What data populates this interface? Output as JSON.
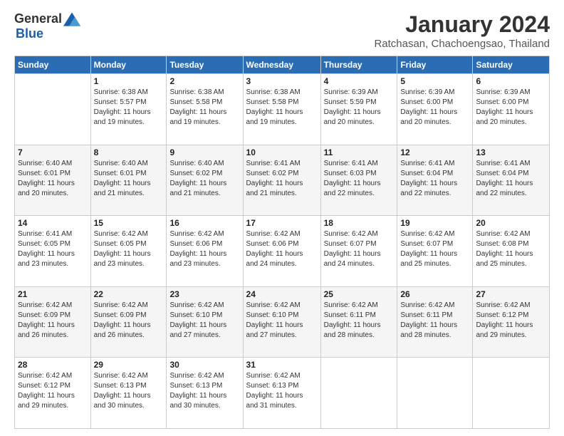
{
  "logo": {
    "general": "General",
    "blue": "Blue"
  },
  "title": "January 2024",
  "location": "Ratchasan, Chachoengsao, Thailand",
  "weekdays": [
    "Sunday",
    "Monday",
    "Tuesday",
    "Wednesday",
    "Thursday",
    "Friday",
    "Saturday"
  ],
  "weeks": [
    [
      {
        "day": "",
        "info": ""
      },
      {
        "day": "1",
        "info": "Sunrise: 6:38 AM\nSunset: 5:57 PM\nDaylight: 11 hours\nand 19 minutes."
      },
      {
        "day": "2",
        "info": "Sunrise: 6:38 AM\nSunset: 5:58 PM\nDaylight: 11 hours\nand 19 minutes."
      },
      {
        "day": "3",
        "info": "Sunrise: 6:38 AM\nSunset: 5:58 PM\nDaylight: 11 hours\nand 19 minutes."
      },
      {
        "day": "4",
        "info": "Sunrise: 6:39 AM\nSunset: 5:59 PM\nDaylight: 11 hours\nand 20 minutes."
      },
      {
        "day": "5",
        "info": "Sunrise: 6:39 AM\nSunset: 6:00 PM\nDaylight: 11 hours\nand 20 minutes."
      },
      {
        "day": "6",
        "info": "Sunrise: 6:39 AM\nSunset: 6:00 PM\nDaylight: 11 hours\nand 20 minutes."
      }
    ],
    [
      {
        "day": "7",
        "info": "Sunrise: 6:40 AM\nSunset: 6:01 PM\nDaylight: 11 hours\nand 20 minutes."
      },
      {
        "day": "8",
        "info": "Sunrise: 6:40 AM\nSunset: 6:01 PM\nDaylight: 11 hours\nand 21 minutes."
      },
      {
        "day": "9",
        "info": "Sunrise: 6:40 AM\nSunset: 6:02 PM\nDaylight: 11 hours\nand 21 minutes."
      },
      {
        "day": "10",
        "info": "Sunrise: 6:41 AM\nSunset: 6:02 PM\nDaylight: 11 hours\nand 21 minutes."
      },
      {
        "day": "11",
        "info": "Sunrise: 6:41 AM\nSunset: 6:03 PM\nDaylight: 11 hours\nand 22 minutes."
      },
      {
        "day": "12",
        "info": "Sunrise: 6:41 AM\nSunset: 6:04 PM\nDaylight: 11 hours\nand 22 minutes."
      },
      {
        "day": "13",
        "info": "Sunrise: 6:41 AM\nSunset: 6:04 PM\nDaylight: 11 hours\nand 22 minutes."
      }
    ],
    [
      {
        "day": "14",
        "info": "Sunrise: 6:41 AM\nSunset: 6:05 PM\nDaylight: 11 hours\nand 23 minutes."
      },
      {
        "day": "15",
        "info": "Sunrise: 6:42 AM\nSunset: 6:05 PM\nDaylight: 11 hours\nand 23 minutes."
      },
      {
        "day": "16",
        "info": "Sunrise: 6:42 AM\nSunset: 6:06 PM\nDaylight: 11 hours\nand 23 minutes."
      },
      {
        "day": "17",
        "info": "Sunrise: 6:42 AM\nSunset: 6:06 PM\nDaylight: 11 hours\nand 24 minutes."
      },
      {
        "day": "18",
        "info": "Sunrise: 6:42 AM\nSunset: 6:07 PM\nDaylight: 11 hours\nand 24 minutes."
      },
      {
        "day": "19",
        "info": "Sunrise: 6:42 AM\nSunset: 6:07 PM\nDaylight: 11 hours\nand 25 minutes."
      },
      {
        "day": "20",
        "info": "Sunrise: 6:42 AM\nSunset: 6:08 PM\nDaylight: 11 hours\nand 25 minutes."
      }
    ],
    [
      {
        "day": "21",
        "info": "Sunrise: 6:42 AM\nSunset: 6:09 PM\nDaylight: 11 hours\nand 26 minutes."
      },
      {
        "day": "22",
        "info": "Sunrise: 6:42 AM\nSunset: 6:09 PM\nDaylight: 11 hours\nand 26 minutes."
      },
      {
        "day": "23",
        "info": "Sunrise: 6:42 AM\nSunset: 6:10 PM\nDaylight: 11 hours\nand 27 minutes."
      },
      {
        "day": "24",
        "info": "Sunrise: 6:42 AM\nSunset: 6:10 PM\nDaylight: 11 hours\nand 27 minutes."
      },
      {
        "day": "25",
        "info": "Sunrise: 6:42 AM\nSunset: 6:11 PM\nDaylight: 11 hours\nand 28 minutes."
      },
      {
        "day": "26",
        "info": "Sunrise: 6:42 AM\nSunset: 6:11 PM\nDaylight: 11 hours\nand 28 minutes."
      },
      {
        "day": "27",
        "info": "Sunrise: 6:42 AM\nSunset: 6:12 PM\nDaylight: 11 hours\nand 29 minutes."
      }
    ],
    [
      {
        "day": "28",
        "info": "Sunrise: 6:42 AM\nSunset: 6:12 PM\nDaylight: 11 hours\nand 29 minutes."
      },
      {
        "day": "29",
        "info": "Sunrise: 6:42 AM\nSunset: 6:13 PM\nDaylight: 11 hours\nand 30 minutes."
      },
      {
        "day": "30",
        "info": "Sunrise: 6:42 AM\nSunset: 6:13 PM\nDaylight: 11 hours\nand 30 minutes."
      },
      {
        "day": "31",
        "info": "Sunrise: 6:42 AM\nSunset: 6:13 PM\nDaylight: 11 hours\nand 31 minutes."
      },
      {
        "day": "",
        "info": ""
      },
      {
        "day": "",
        "info": ""
      },
      {
        "day": "",
        "info": ""
      }
    ]
  ]
}
